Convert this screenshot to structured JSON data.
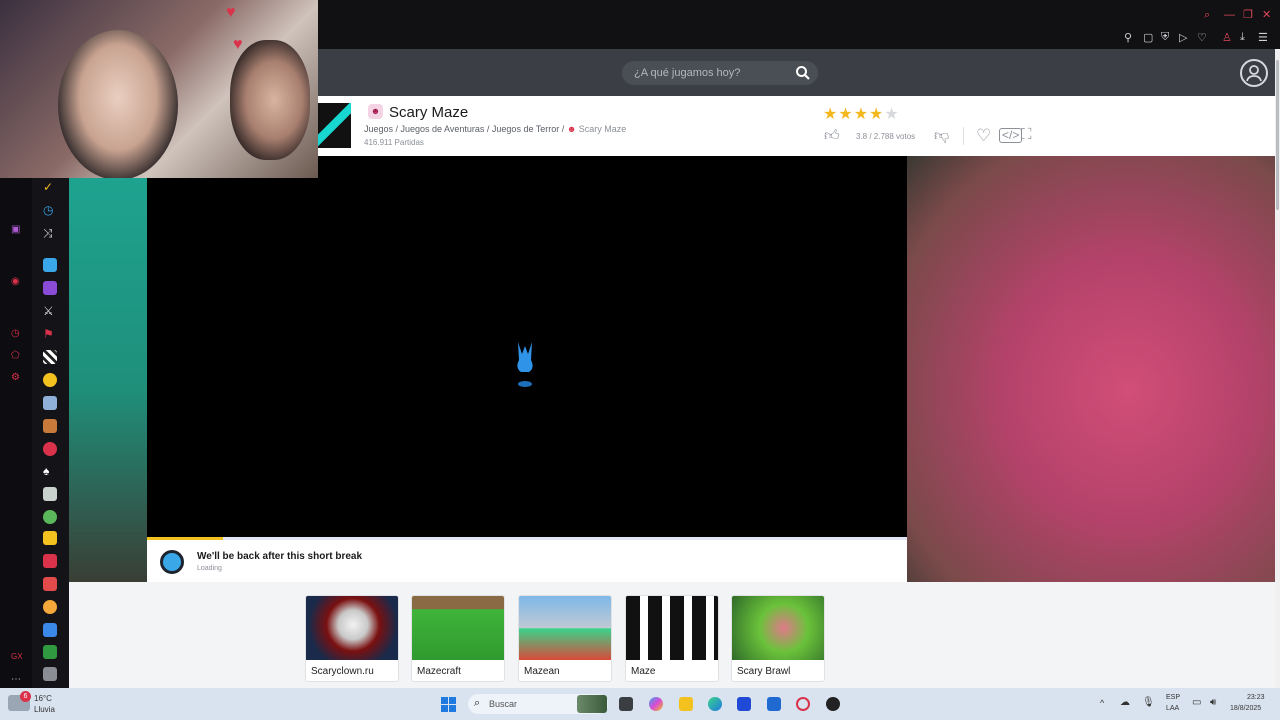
{
  "site": {
    "search_placeholder": "¿A qué jugamos hoy?"
  },
  "game": {
    "title": "Scary Maze",
    "breadcrumb": "Juegos / Juegos de Aventuras / Juegos de Terror /",
    "breadcrumb_current": "Scary Maze",
    "plays": "416.911 Partidas",
    "rating_stars": "★★★★★",
    "rating_text": "3.8 / 2.788 votos",
    "rating_value": 3.8
  },
  "player": {
    "ad_title": "We'll be back after this short break",
    "ad_subtitle": "Loading",
    "load_progress": 0.1
  },
  "related": [
    {
      "label": "Scaryclown.ru"
    },
    {
      "label": "Mazecraft"
    },
    {
      "label": "Mazean"
    },
    {
      "label": "Maze"
    },
    {
      "label": "Scary Brawl"
    }
  ],
  "taskbar": {
    "weather_temp": "16°C",
    "weather_desc": "Lluvia",
    "search_label": "Buscar",
    "lang_top": "ESP",
    "lang_bottom": "LAA",
    "time": "23:23",
    "date": "18/8/2025",
    "notif_count": "6"
  },
  "colors": {
    "accent_red": "#d9324a",
    "header_bg": "#3b3f45",
    "star": "#f4b81f"
  }
}
